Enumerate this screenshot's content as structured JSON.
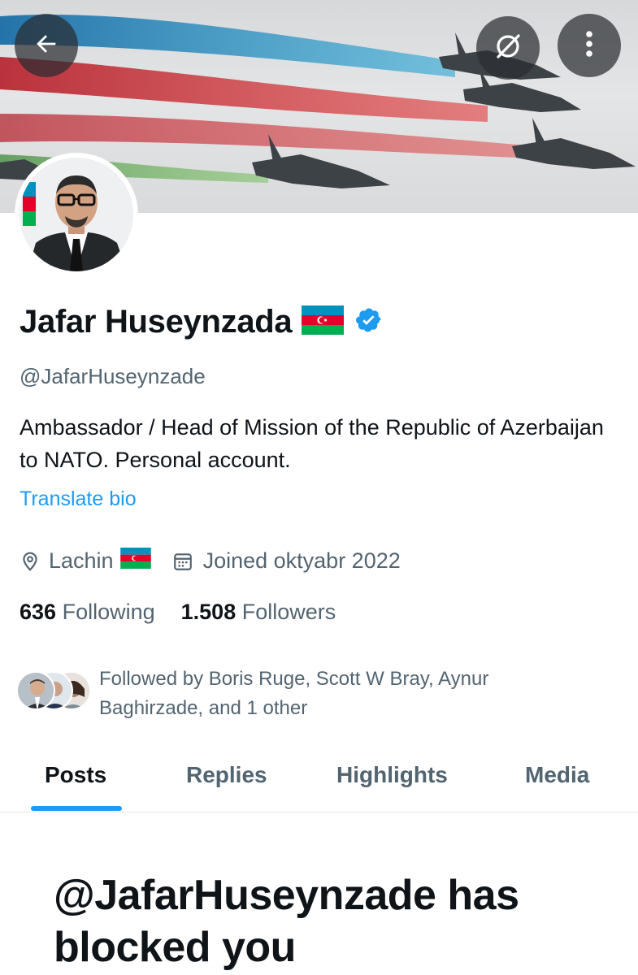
{
  "header": {
    "back_icon": "arrow-left-icon",
    "grok_icon": "grok-slash-icon",
    "more_icon": "more-vertical-icon"
  },
  "profile": {
    "name": "Jafar Huseynzada",
    "handle": "@JafarHuseynzade",
    "bio": "Ambassador / Head of Mission of the Republic of Azerbaijan to NATO. Personal account.",
    "translate_bio": "Translate bio",
    "location": "Lachin",
    "joined": "Joined oktyabr 2022",
    "following_count": "636",
    "following_label": "Following",
    "followers_count": "1.508",
    "followers_label": "Followers",
    "followed_by": "Followed by Boris Ruge, Scott W Bray, Aynur Baghirzade, and 1 other"
  },
  "tabs": [
    {
      "label": "Posts",
      "active": true
    },
    {
      "label": "Replies",
      "active": false
    },
    {
      "label": "Highlights",
      "active": false
    },
    {
      "label": "Media",
      "active": false
    }
  ],
  "blocked_message": "@JafarHuseynzade has blocked you",
  "colors": {
    "accent": "#1d9bf0",
    "secondary_text": "#536471",
    "primary_text": "#0f1419",
    "flag_blue": "#0092bc",
    "flag_red": "#e4002b",
    "flag_green": "#00af50"
  }
}
